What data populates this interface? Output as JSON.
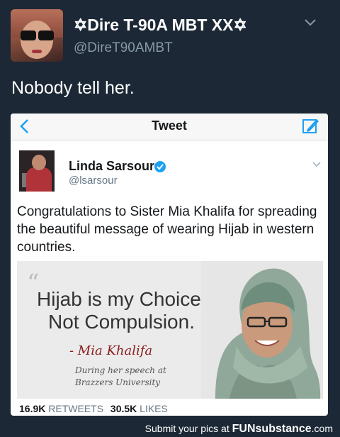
{
  "outer_tweet": {
    "display_name": "✡Dire T-90A MBT XX✡",
    "handle": "@DireT90AMBT",
    "text": "Nobody tell her."
  },
  "embedded_screen": {
    "nav": {
      "title": "Tweet"
    },
    "tweet": {
      "display_name": "Linda Sarsour",
      "handle": "@lsarsour",
      "text": "Congratulations to Sister Mia Khalifa for spreading the beautiful message of wearing Hijab in western countries.",
      "media": {
        "quote_mark": "“",
        "quote_line_1": "Hijab is my Choice,",
        "quote_line_2": "Not Compulsion.",
        "author": "- Mia Khalifa",
        "caption_line_1": "During her speech at",
        "caption_line_2": "Brazzers University"
      },
      "stats": {
        "retweets_count": "16.9K",
        "retweets_label": "RETWEETS",
        "likes_count": "30.5K",
        "likes_label": "LIKES"
      }
    }
  },
  "footer": {
    "text": "Submit your pics at",
    "brand_prefix": "FUN",
    "brand_suffix": "substance",
    "brand_domain": ".com"
  },
  "colors": {
    "background": "#1c2835",
    "link_blue": "#1da1f2",
    "secondary_text": "#8899a6"
  }
}
